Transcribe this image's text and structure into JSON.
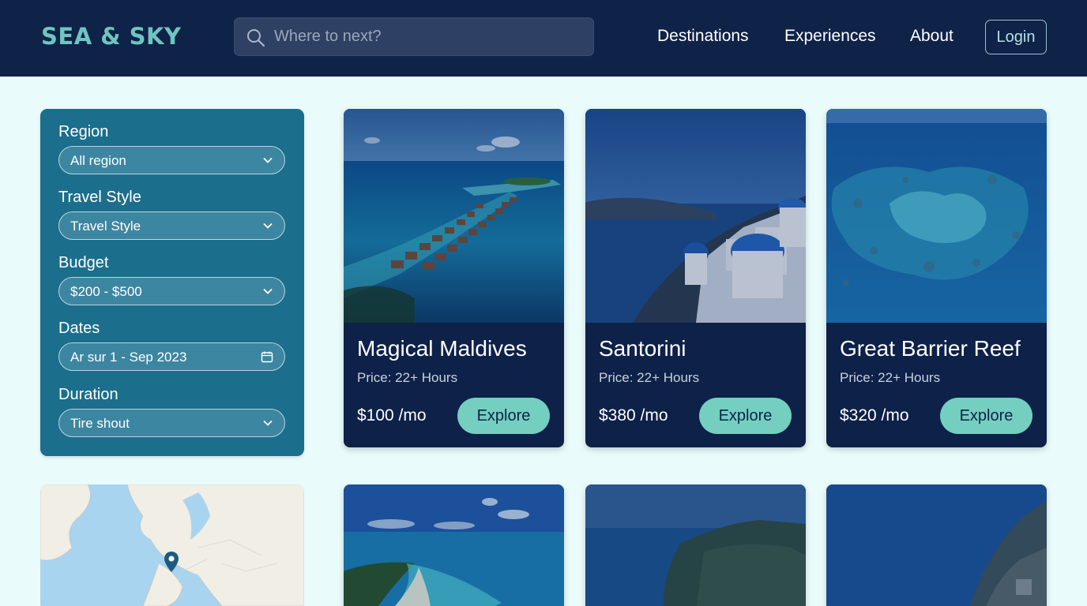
{
  "header": {
    "logo": "SEA & SKY",
    "search": {
      "placeholder": "Where to next?",
      "icon": "search-icon"
    },
    "nav": [
      "Destinations",
      "Experiences",
      "About"
    ],
    "login": "Login"
  },
  "filters": {
    "region": {
      "label": "Region",
      "value": "All region"
    },
    "travel_style": {
      "label": "Travel Style",
      "value": "Travel Style"
    },
    "budget": {
      "label": "Budget",
      "value": "$200 - $500"
    },
    "dates": {
      "label": "Dates",
      "value": "Ar sur 1 - Sep 2023",
      "icon": "calendar-icon"
    },
    "duration": {
      "label": "Duration",
      "value": "Tire shout"
    }
  },
  "cards": [
    {
      "title": "Magical Maldives",
      "subtitle": "Price: 22+ Hours",
      "price": "$100 /mo",
      "button": "Explore"
    },
    {
      "title": "Santorini",
      "subtitle": "Price: 22+ Hours",
      "price": "$380 /mo",
      "button": "Explore"
    },
    {
      "title": "Great Barrier Reef",
      "subtitle": "Price: 22+ Hours",
      "price": "$320 /mo",
      "button": "Explore"
    }
  ],
  "colors": {
    "header_bg": "#0f2248",
    "accent": "#74cfc0",
    "filter_panel": "#1b6e8c",
    "card_bg": "#0d2149",
    "page_bg": "#e9fbfb"
  }
}
